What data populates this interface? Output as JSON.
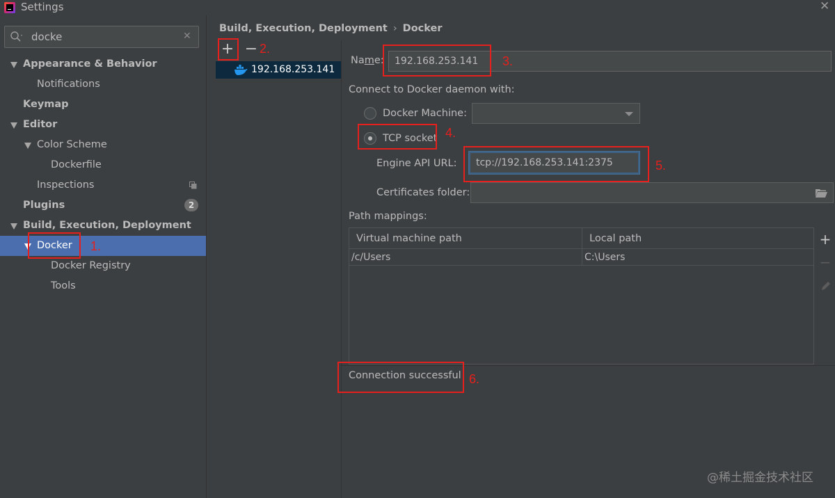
{
  "window": {
    "title": "Settings"
  },
  "search": {
    "value": "docke"
  },
  "sidebar": {
    "items": [
      {
        "label": "Appearance & Behavior"
      },
      {
        "label": "Notifications"
      },
      {
        "label": "Keymap"
      },
      {
        "label": "Editor"
      },
      {
        "label": "Color Scheme"
      },
      {
        "label": "Dockerfile"
      },
      {
        "label": "Inspections"
      },
      {
        "label": "Plugins",
        "badge": "2"
      },
      {
        "label": "Build, Execution, Deployment"
      },
      {
        "label": "Docker"
      },
      {
        "label": "Docker Registry"
      },
      {
        "label": "Tools"
      }
    ]
  },
  "breadcrumb": {
    "parent": "Build, Execution, Deployment",
    "separator": "›",
    "current": "Docker"
  },
  "toolbar": {
    "add_label": "+",
    "remove_label": "−"
  },
  "servers": {
    "items": [
      "192.168.253.141"
    ]
  },
  "form": {
    "name_label_pre": "Na",
    "name_label_underlined": "m",
    "name_label_post": "e:",
    "name_value": "192.168.253.141",
    "connect_label": "Connect to Docker daemon with:",
    "docker_machine_label": "Docker Machine:",
    "tcp_label": "TCP socket",
    "api_url_label": "Engine API URL:",
    "api_url_value": "tcp://192.168.253.141:2375",
    "cert_label": "Certificates folder:",
    "cert_value": "",
    "path_mappings_label": "Path mappings:"
  },
  "path_table": {
    "headers": [
      "Virtual machine path",
      "Local path"
    ],
    "rows": [
      [
        "/c/Users",
        "C:\\Users"
      ]
    ]
  },
  "status": {
    "text": "Connection successful"
  },
  "annotations": [
    "1.",
    "2.",
    "3.",
    "4.",
    "5.",
    "6."
  ],
  "watermark": "@稀土掘金技术社区",
  "colors": {
    "accent_selected": "#4b6eaf",
    "annotation": "#e5201d",
    "list_selected": "#0d293e"
  }
}
